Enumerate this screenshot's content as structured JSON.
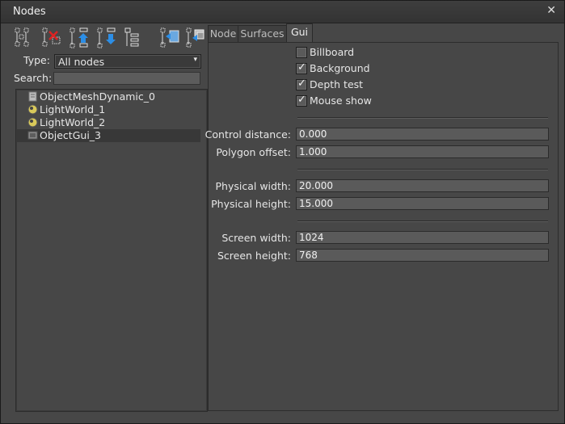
{
  "window": {
    "title": "Nodes",
    "close_label": "✕"
  },
  "toolbar": {
    "buttons": [
      {
        "name": "add-node-icon"
      },
      {
        "name": "remove-node-icon"
      },
      {
        "name": "move-up-icon"
      },
      {
        "name": "move-down-icon"
      },
      {
        "name": "node-list-icon"
      },
      {
        "name": "import-node-icon"
      },
      {
        "name": "export-node-icon"
      }
    ]
  },
  "filter": {
    "type_label": "Type:",
    "type_value": "All nodes",
    "search_label": "Search:",
    "search_value": ""
  },
  "tree": {
    "items": [
      {
        "label": "ObjectMeshDynamic_0",
        "icon": "mesh-icon",
        "selected": false
      },
      {
        "label": "LightWorld_1",
        "icon": "light-world-icon",
        "selected": false
      },
      {
        "label": "LightWorld_2",
        "icon": "light-world-icon",
        "selected": false
      },
      {
        "label": "ObjectGui_3",
        "icon": "gui-object-icon",
        "selected": true
      }
    ]
  },
  "tabs": [
    {
      "label": "Node",
      "active": false
    },
    {
      "label": "Surfaces",
      "active": false
    },
    {
      "label": "Gui",
      "active": true
    }
  ],
  "gui": {
    "checkboxes": [
      {
        "label": "Billboard",
        "checked": false
      },
      {
        "label": "Background",
        "checked": true
      },
      {
        "label": "Depth test",
        "checked": true
      },
      {
        "label": "Mouse show",
        "checked": true
      }
    ],
    "fields": {
      "control_distance": {
        "label": "Control distance:",
        "value": "0.000"
      },
      "polygon_offset": {
        "label": "Polygon offset:",
        "value": "1.000"
      },
      "physical_width": {
        "label": "Physical width:",
        "value": "20.000"
      },
      "physical_height": {
        "label": "Physical height:",
        "value": "15.000"
      },
      "screen_width": {
        "label": "Screen width:",
        "value": "1024"
      },
      "screen_height": {
        "label": "Screen height:",
        "value": "768"
      }
    }
  }
}
